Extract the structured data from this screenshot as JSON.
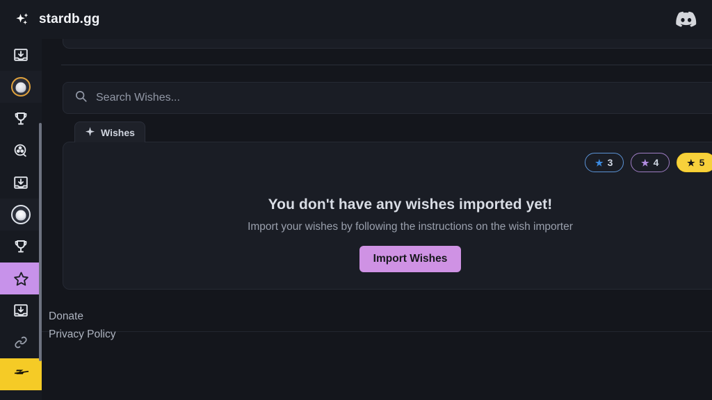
{
  "header": {
    "brand_name": "stardb.gg",
    "brand_icon": "sparkles-icon",
    "discord_icon": "discord-icon"
  },
  "sidebar": {
    "items": [
      {
        "id": "import-box-1",
        "icon": "import-download-icon",
        "label": "",
        "state": "default"
      },
      {
        "id": "avatar-1",
        "icon": "avatar-gold-ring",
        "label": "",
        "state": "highlighted"
      },
      {
        "id": "trophy-1",
        "icon": "trophy-icon",
        "label": "",
        "state": "default"
      },
      {
        "id": "film-reel",
        "icon": "film-reel-icon",
        "label": "",
        "state": "default"
      },
      {
        "id": "import-box-2",
        "icon": "import-download-icon",
        "label": "",
        "state": "default"
      },
      {
        "id": "avatar-2",
        "icon": "avatar-pale-ring",
        "label": "",
        "state": "highlighted"
      },
      {
        "id": "trophy-2",
        "icon": "trophy-icon",
        "label": "",
        "state": "default"
      },
      {
        "id": "warp-star",
        "icon": "star-outline-icon",
        "label": "",
        "state": "active"
      },
      {
        "id": "import-box-3",
        "icon": "import-download-icon",
        "label": "",
        "state": "default"
      },
      {
        "id": "link",
        "icon": "link-chain-icon",
        "label": "",
        "state": "default"
      },
      {
        "id": "zzz",
        "icon": "zzz-logo-icon",
        "label": "",
        "state": "brand"
      }
    ],
    "scrollbar": "vertical-scrollbar"
  },
  "search": {
    "placeholder": "Search Wishes...",
    "value": "",
    "icon": "search-icon"
  },
  "tab": {
    "label": "Wishes",
    "icon": "sparkle-icon"
  },
  "filters": {
    "rarity_pills": [
      {
        "label": "3",
        "star": "★",
        "active": false,
        "color": "#3c8ae0"
      },
      {
        "label": "4",
        "star": "★",
        "active": false,
        "color": "#b18ce0"
      },
      {
        "label": "5",
        "star": "★",
        "active": true,
        "color": "#f7d13b"
      },
      {
        "label": "",
        "star": "",
        "active": false,
        "color": "#3a3f4c"
      }
    ]
  },
  "empty_state": {
    "title": "You don't have any wishes imported yet!",
    "subtitle": "Import your wishes by following the instructions on the wish importer",
    "button_label": "Import Wishes",
    "button_color": "#cf92e4"
  },
  "footer": {
    "links": [
      {
        "label": "Donate"
      },
      {
        "label": "Privacy Policy"
      }
    ]
  }
}
